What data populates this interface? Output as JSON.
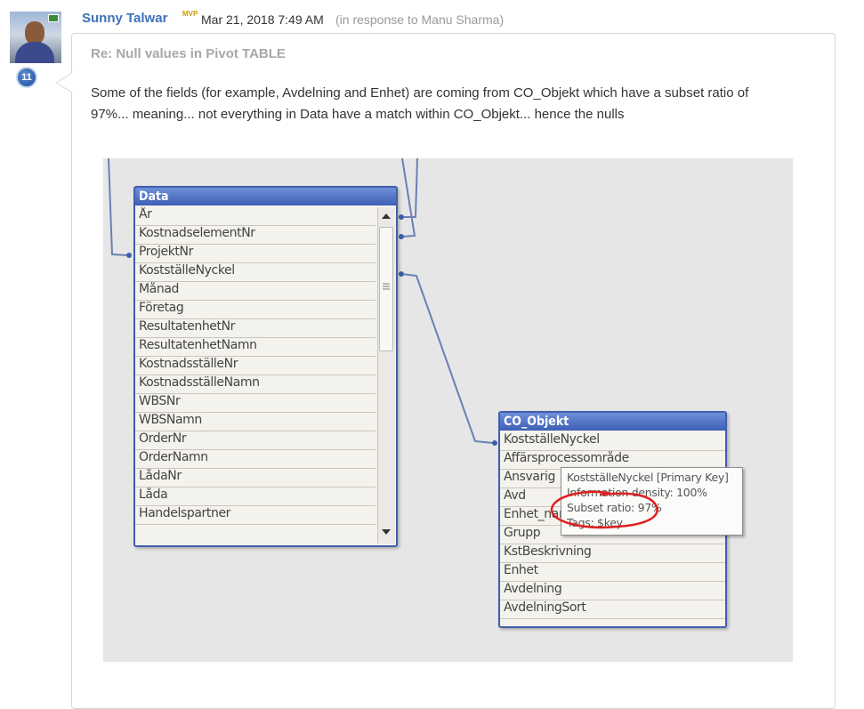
{
  "post": {
    "author": "Sunny Talwar",
    "badge": "MVP",
    "date": "Mar 21, 2018 7:49 AM",
    "response_prefix": "(in response to",
    "response_to": "Manu Sharma",
    "response_suffix": ")",
    "level_badge": "11",
    "subject": "Re: Null values in Pivot TABLE",
    "body_line1": "Some of the fields (for example, Avdelning and Enhet) are coming from CO_Objekt which have a subset ratio of",
    "body_line2": "97%... meaning... not everything in Data have a match within CO_Objekt... hence the nulls"
  },
  "diagram": {
    "data_table": {
      "title": "Data",
      "fields": [
        "År",
        "KostnadselementNr",
        "ProjektNr",
        "KostställeNyckel",
        "Månad",
        "Företag",
        "ResultatenhetNr",
        "ResultatenhetNamn",
        "KostnadsställeNr",
        "KostnadsställeNamn",
        "WBSNr",
        "WBSNamn",
        "OrderNr",
        "OrderNamn",
        "LådaNr",
        "Låda",
        "Handelspartner"
      ]
    },
    "co_table": {
      "title": "CO_Objekt",
      "fields": [
        "KostställeNyckel",
        "Affärsprocessområde",
        "Ansvarig",
        "Avd",
        "Enhet_namn",
        "Grupp",
        "KstBeskrivning",
        "Enhet",
        "Avdelning",
        "AvdelningSort"
      ]
    },
    "tooltip": {
      "line1": "KostställeNyckel [Primary Key]",
      "line2": "Information density: 100%",
      "line3": "Subset ratio: 97%",
      "line4": "Tags: $key"
    },
    "colors": {
      "link": "#6a7fb4",
      "table_header": "#3d5fb6",
      "highlight_circle": "#e02020",
      "background": "#e6e6e6"
    }
  }
}
